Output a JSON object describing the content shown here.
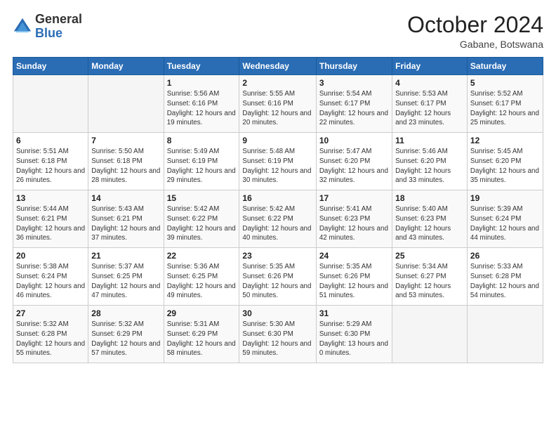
{
  "logo": {
    "general": "General",
    "blue": "Blue"
  },
  "header": {
    "monthYear": "October 2024",
    "location": "Gabane, Botswana"
  },
  "calendar": {
    "headers": [
      "Sunday",
      "Monday",
      "Tuesday",
      "Wednesday",
      "Thursday",
      "Friday",
      "Saturday"
    ],
    "weeks": [
      [
        {
          "day": "",
          "info": ""
        },
        {
          "day": "",
          "info": ""
        },
        {
          "day": "1",
          "info": "Sunrise: 5:56 AM\nSunset: 6:16 PM\nDaylight: 12 hours\nand 19 minutes."
        },
        {
          "day": "2",
          "info": "Sunrise: 5:55 AM\nSunset: 6:16 PM\nDaylight: 12 hours\nand 20 minutes."
        },
        {
          "day": "3",
          "info": "Sunrise: 5:54 AM\nSunset: 6:17 PM\nDaylight: 12 hours\nand 22 minutes."
        },
        {
          "day": "4",
          "info": "Sunrise: 5:53 AM\nSunset: 6:17 PM\nDaylight: 12 hours\nand 23 minutes."
        },
        {
          "day": "5",
          "info": "Sunrise: 5:52 AM\nSunset: 6:17 PM\nDaylight: 12 hours\nand 25 minutes."
        }
      ],
      [
        {
          "day": "6",
          "info": "Sunrise: 5:51 AM\nSunset: 6:18 PM\nDaylight: 12 hours\nand 26 minutes."
        },
        {
          "day": "7",
          "info": "Sunrise: 5:50 AM\nSunset: 6:18 PM\nDaylight: 12 hours\nand 28 minutes."
        },
        {
          "day": "8",
          "info": "Sunrise: 5:49 AM\nSunset: 6:19 PM\nDaylight: 12 hours\nand 29 minutes."
        },
        {
          "day": "9",
          "info": "Sunrise: 5:48 AM\nSunset: 6:19 PM\nDaylight: 12 hours\nand 30 minutes."
        },
        {
          "day": "10",
          "info": "Sunrise: 5:47 AM\nSunset: 6:20 PM\nDaylight: 12 hours\nand 32 minutes."
        },
        {
          "day": "11",
          "info": "Sunrise: 5:46 AM\nSunset: 6:20 PM\nDaylight: 12 hours\nand 33 minutes."
        },
        {
          "day": "12",
          "info": "Sunrise: 5:45 AM\nSunset: 6:20 PM\nDaylight: 12 hours\nand 35 minutes."
        }
      ],
      [
        {
          "day": "13",
          "info": "Sunrise: 5:44 AM\nSunset: 6:21 PM\nDaylight: 12 hours\nand 36 minutes."
        },
        {
          "day": "14",
          "info": "Sunrise: 5:43 AM\nSunset: 6:21 PM\nDaylight: 12 hours\nand 37 minutes."
        },
        {
          "day": "15",
          "info": "Sunrise: 5:42 AM\nSunset: 6:22 PM\nDaylight: 12 hours\nand 39 minutes."
        },
        {
          "day": "16",
          "info": "Sunrise: 5:42 AM\nSunset: 6:22 PM\nDaylight: 12 hours\nand 40 minutes."
        },
        {
          "day": "17",
          "info": "Sunrise: 5:41 AM\nSunset: 6:23 PM\nDaylight: 12 hours\nand 42 minutes."
        },
        {
          "day": "18",
          "info": "Sunrise: 5:40 AM\nSunset: 6:23 PM\nDaylight: 12 hours\nand 43 minutes."
        },
        {
          "day": "19",
          "info": "Sunrise: 5:39 AM\nSunset: 6:24 PM\nDaylight: 12 hours\nand 44 minutes."
        }
      ],
      [
        {
          "day": "20",
          "info": "Sunrise: 5:38 AM\nSunset: 6:24 PM\nDaylight: 12 hours\nand 46 minutes."
        },
        {
          "day": "21",
          "info": "Sunrise: 5:37 AM\nSunset: 6:25 PM\nDaylight: 12 hours\nand 47 minutes."
        },
        {
          "day": "22",
          "info": "Sunrise: 5:36 AM\nSunset: 6:25 PM\nDaylight: 12 hours\nand 49 minutes."
        },
        {
          "day": "23",
          "info": "Sunrise: 5:35 AM\nSunset: 6:26 PM\nDaylight: 12 hours\nand 50 minutes."
        },
        {
          "day": "24",
          "info": "Sunrise: 5:35 AM\nSunset: 6:26 PM\nDaylight: 12 hours\nand 51 minutes."
        },
        {
          "day": "25",
          "info": "Sunrise: 5:34 AM\nSunset: 6:27 PM\nDaylight: 12 hours\nand 53 minutes."
        },
        {
          "day": "26",
          "info": "Sunrise: 5:33 AM\nSunset: 6:28 PM\nDaylight: 12 hours\nand 54 minutes."
        }
      ],
      [
        {
          "day": "27",
          "info": "Sunrise: 5:32 AM\nSunset: 6:28 PM\nDaylight: 12 hours\nand 55 minutes."
        },
        {
          "day": "28",
          "info": "Sunrise: 5:32 AM\nSunset: 6:29 PM\nDaylight: 12 hours\nand 57 minutes."
        },
        {
          "day": "29",
          "info": "Sunrise: 5:31 AM\nSunset: 6:29 PM\nDaylight: 12 hours\nand 58 minutes."
        },
        {
          "day": "30",
          "info": "Sunrise: 5:30 AM\nSunset: 6:30 PM\nDaylight: 12 hours\nand 59 minutes."
        },
        {
          "day": "31",
          "info": "Sunrise: 5:29 AM\nSunset: 6:30 PM\nDaylight: 13 hours\nand 0 minutes."
        },
        {
          "day": "",
          "info": ""
        },
        {
          "day": "",
          "info": ""
        }
      ]
    ]
  }
}
